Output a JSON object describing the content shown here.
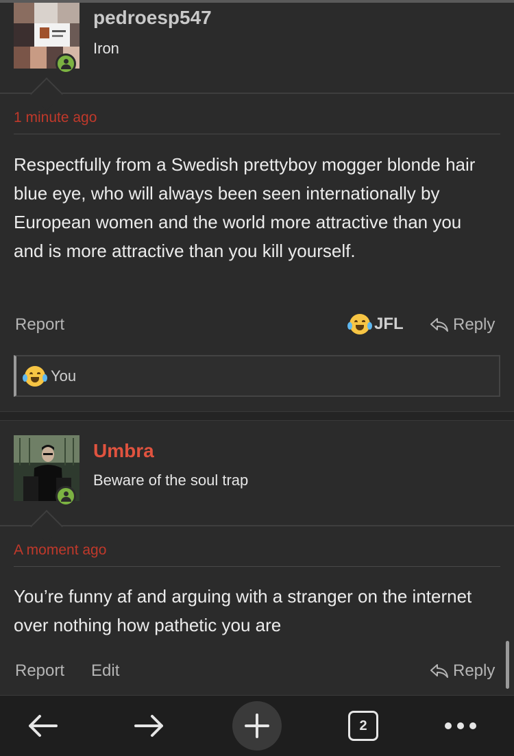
{
  "posts": [
    {
      "username": "pedroesp547",
      "username_color": "#c9c9c9",
      "user_title": "Iron",
      "timestamp": "1 minute ago",
      "body": "Respectfully from a Swedish prettyboy mogger blonde hair blue eye, who will always been seen internationally by European women and the world more attractive than you and is more attractive than you kill yourself.",
      "actions": {
        "report": "Report",
        "reaction": "JFL",
        "reply": "Reply"
      },
      "reactions_summary": "You"
    },
    {
      "username": "Umbra",
      "username_color": "#e0533f",
      "user_title": "Beware of the soul trap",
      "timestamp": "A moment ago",
      "body": "You’re funny af and arguing with a stranger on the internet over nothing how pathetic you are",
      "actions": {
        "report": "Report",
        "edit": "Edit",
        "reply": "Reply"
      }
    }
  ],
  "browser_bar": {
    "tab_count": "2",
    "icons": [
      "back-arrow-icon",
      "forward-arrow-icon",
      "plus-icon",
      "tabs-icon",
      "more-icon"
    ]
  },
  "colors": {
    "background": "#2b2b2b",
    "timestamp": "#c0392b",
    "online": "#7cb342"
  }
}
